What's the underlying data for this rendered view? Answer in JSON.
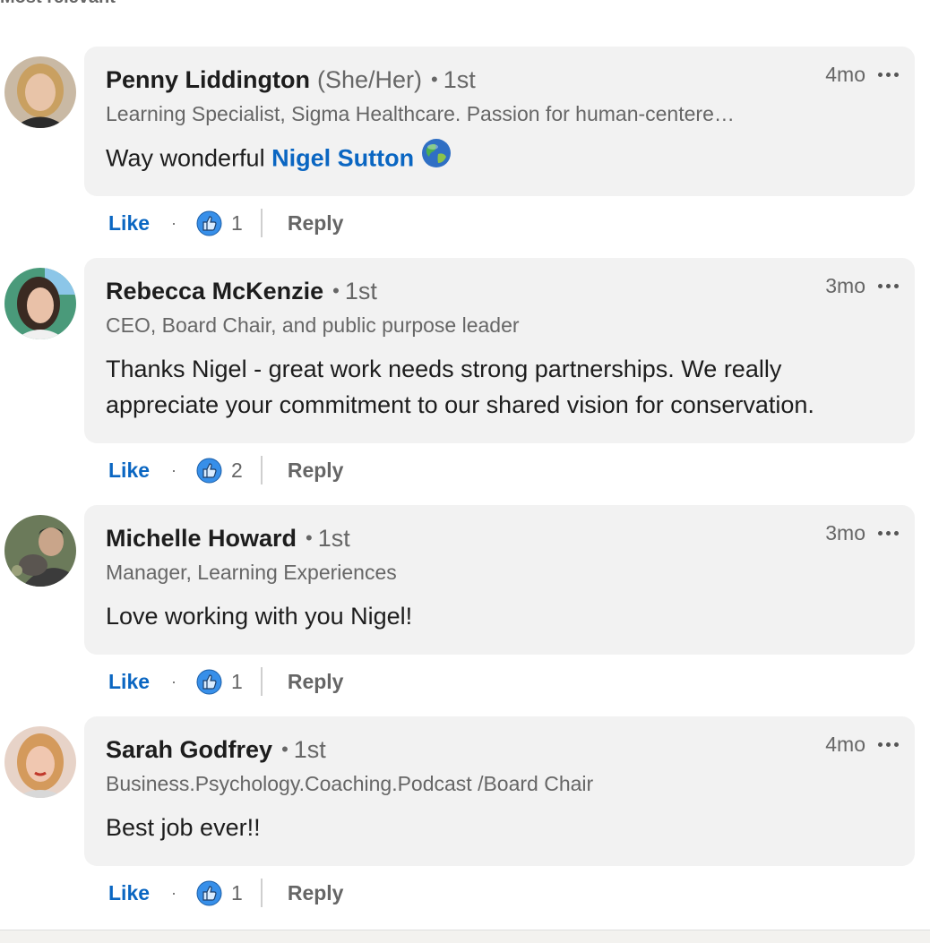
{
  "sort_label": "Most relevant",
  "comments": [
    {
      "name": "Penny Liddington",
      "pronouns": "(She/Her)",
      "degree": "1st",
      "time": "4mo",
      "headline": "Learning Specialist, Sigma Healthcare. Passion for human-centere…",
      "text_before": "Way wonderful ",
      "mention": "Nigel Sutton",
      "text": "",
      "like_label": "Like",
      "reaction_count": "1",
      "reply_label": "Reply",
      "avatar_colors": {
        "bg": "#c9b9a4",
        "hair": "#c9a061",
        "face": "#e8c4a8",
        "shirt": "#2b2b2b"
      }
    },
    {
      "name": "Rebecca McKenzie",
      "degree": "1st",
      "time": "3mo",
      "headline": "CEO, Board Chair, and public purpose leader",
      "text": "Thanks Nigel - great work needs strong partnerships. We really appreciate your commitment to our shared vision for conservation.",
      "like_label": "Like",
      "reaction_count": "2",
      "reply_label": "Reply",
      "avatar_colors": {
        "bg": "#4a9a7a",
        "hair": "#3a2a22",
        "face": "#e9c1a8",
        "shirt": "#f0f0f0"
      }
    },
    {
      "name": "Michelle Howard",
      "degree": "1st",
      "time": "3mo",
      "headline": "Manager, Learning Experiences",
      "text": "Love working with you Nigel!",
      "like_label": "Like",
      "reaction_count": "1",
      "reply_label": "Reply",
      "avatar_colors": {
        "bg": "#6b7a5a",
        "hair": "#2a2a2a",
        "face": "#c9a58a",
        "shirt": "#3b3b3b"
      }
    },
    {
      "name": "Sarah Godfrey",
      "degree": "1st",
      "time": "4mo",
      "headline": "Business.Psychology.Coaching.Podcast /Board Chair",
      "text": "Best job ever!!",
      "like_label": "Like",
      "reaction_count": "1",
      "reply_label": "Reply",
      "avatar_colors": {
        "bg": "#e7d3c8",
        "hair": "#d49a5c",
        "face": "#f0c7b0",
        "shirt": "#d8d8d8"
      }
    }
  ],
  "colors": {
    "accent": "#0a66c2",
    "bubble": "#f2f2f2",
    "muted": "#666666"
  },
  "icons": {
    "reaction": "thumbs-up-icon",
    "globe": "globe-icon",
    "more": "more-options-icon"
  }
}
